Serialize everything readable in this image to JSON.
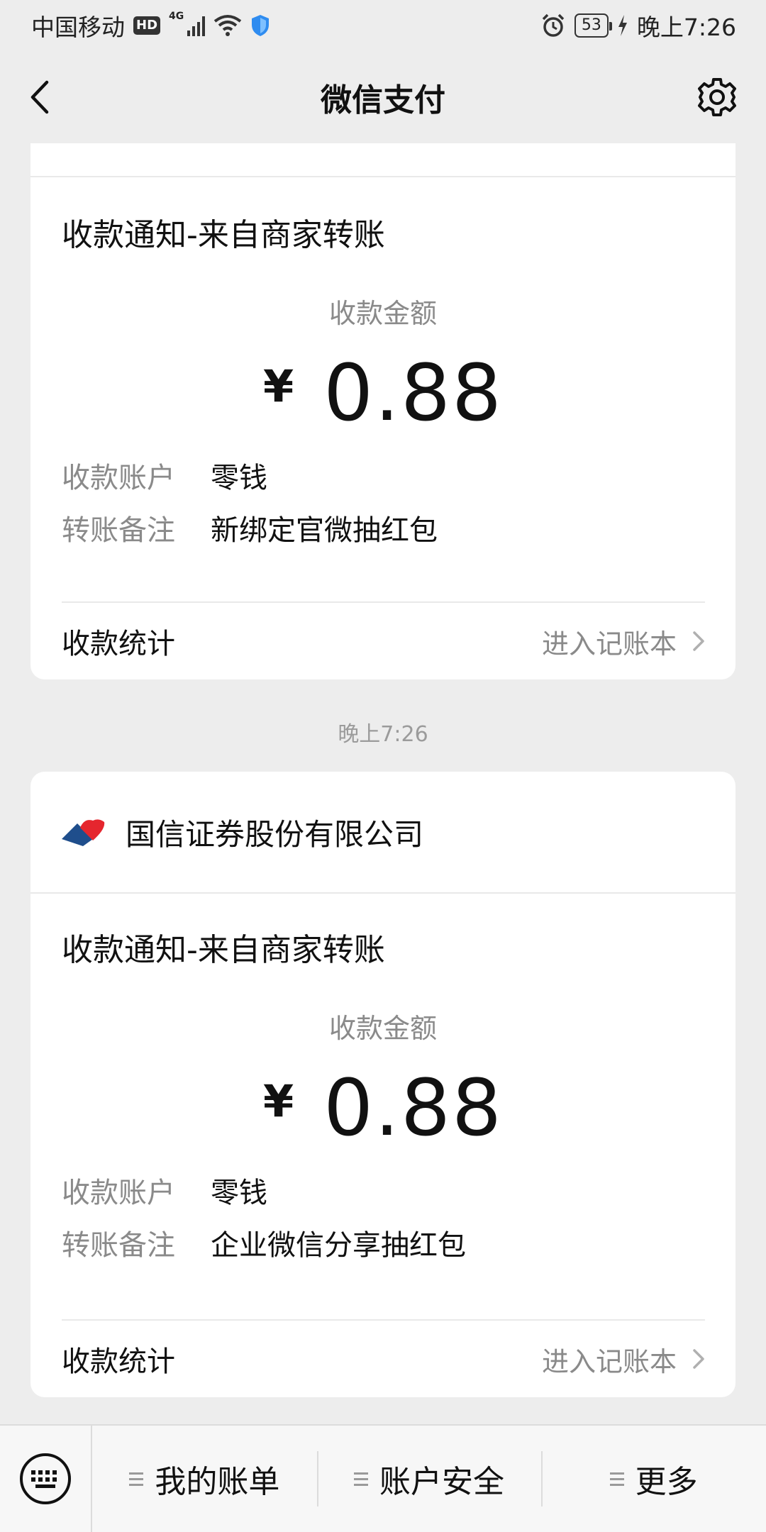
{
  "status_bar": {
    "carrier": "中国移动",
    "hd_badge": "HD",
    "network": "4G",
    "battery": "53",
    "time": "晚上7:26"
  },
  "nav": {
    "title": "微信支付"
  },
  "messages": [
    {
      "notice_title": "收款通知-来自商家转账",
      "amount_label": "收款金额",
      "currency": "¥",
      "amount": "0.88",
      "account_label": "收款账户",
      "account_value": "零钱",
      "remark_label": "转账备注",
      "remark_value": "新绑定官微抽红包",
      "stats_label": "收款统计",
      "stats_link": "进入记账本"
    },
    {
      "merchant": "国信证券股份有限公司",
      "notice_title": "收款通知-来自商家转账",
      "amount_label": "收款金额",
      "currency": "¥",
      "amount": "0.88",
      "account_label": "收款账户",
      "account_value": "零钱",
      "remark_label": "转账备注",
      "remark_value": "企业微信分享抽红包",
      "stats_label": "收款统计",
      "stats_link": "进入记账本"
    }
  ],
  "timestamp": "晚上7:26",
  "bottom_menu": {
    "items": [
      "我的账单",
      "账户安全",
      "更多"
    ]
  },
  "colors": {
    "background": "#ededed",
    "card": "#ffffff",
    "muted_text": "#8a8a8a",
    "logo_red": "#e5262e",
    "logo_blue": "#1f4e8c"
  },
  "icons": [
    "back-arrow-icon",
    "gear-icon",
    "keyboard-icon",
    "menu-icon",
    "chevron-right-icon",
    "shield-icon",
    "wifi-icon",
    "alarm-icon",
    "charging-icon"
  ]
}
